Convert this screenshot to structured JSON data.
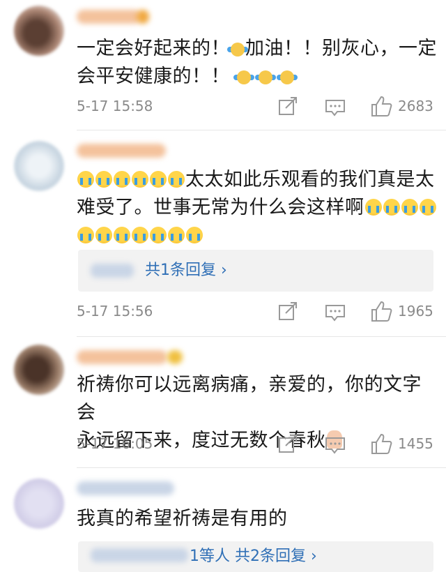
{
  "comments": [
    {
      "text_line1": "一定会好起来的！",
      "text_line1b": "加油！！别灰心，一定",
      "text_line2": "会平安健康的！！",
      "time": "5-17 15:58",
      "likes": "2683"
    },
    {
      "text_line1": "太太如此乐观看的我们真是太",
      "text_line2": "难受了。世事无常为什么会这样啊",
      "reply_label": "共1条回复 ›",
      "time": "5-17 15:56",
      "likes": "1965"
    },
    {
      "text_line1": "祈祷你可以远离病痛，亲爱的，你的文字会",
      "text_line2": "永远留下来，度过无数个春秋",
      "time": "5-17 16:05",
      "likes": "1455"
    },
    {
      "text_line1": "我真的希望祈祷是有用的",
      "reply_label": "1等人  共2条回复 ›"
    }
  ],
  "icons": {
    "share": "share-icon",
    "comment": "comment-icon",
    "like": "thumbs-up-icon"
  },
  "colors": {
    "link": "#2f6fb6",
    "meta": "#8a8a8a"
  }
}
